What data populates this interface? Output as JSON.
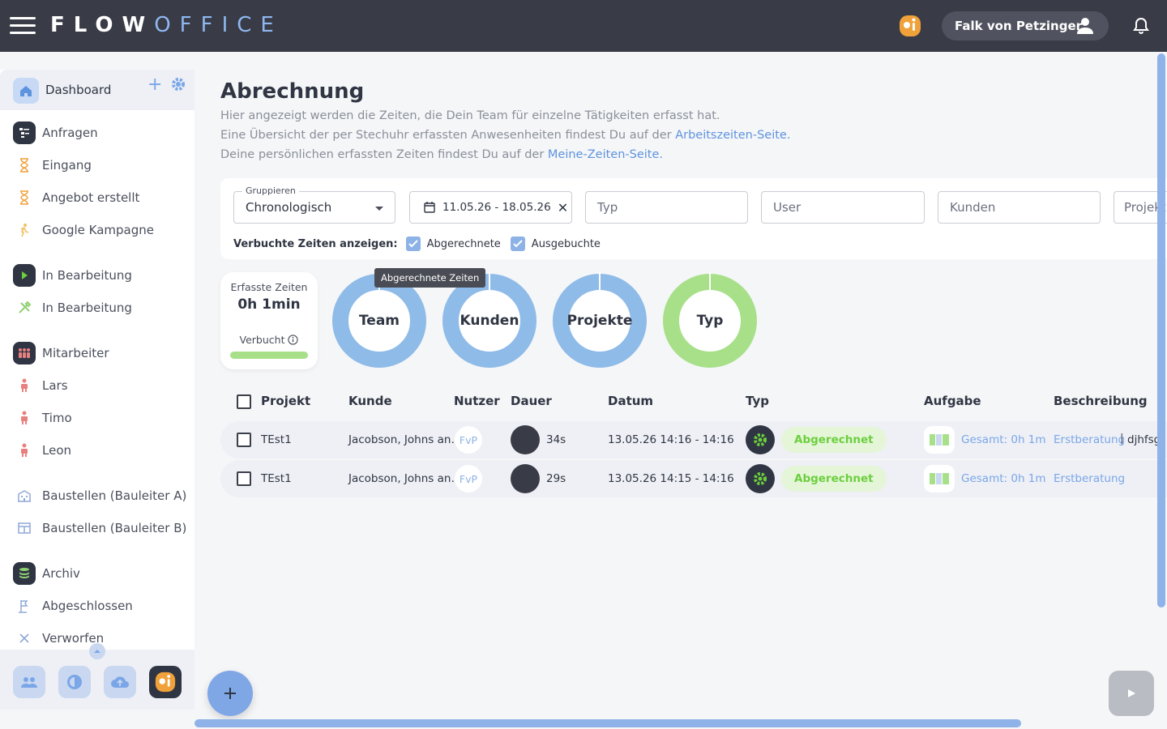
{
  "topbar": {
    "logo_bold": "FLOW",
    "logo_light": "OFFICE",
    "user_name": "Falk von Petzinger"
  },
  "sidebar": {
    "header_label": "Dashboard",
    "items": [
      {
        "label": "Anfragen",
        "icon": "inbox-list-icon"
      },
      {
        "label": "Eingang",
        "icon": "hourglass-icon"
      },
      {
        "label": "Angebot erstellt",
        "icon": "hourglass-icon"
      },
      {
        "label": "Google Kampagne",
        "icon": "walking-person-icon"
      },
      {
        "label": "In Bearbeitung",
        "icon": "play-icon"
      },
      {
        "label": "In Bearbeitung",
        "icon": "tools-icon"
      },
      {
        "label": "Mitarbeiter",
        "icon": "people-icon"
      },
      {
        "label": "Lars",
        "icon": "person-icon"
      },
      {
        "label": "Timo",
        "icon": "person-icon"
      },
      {
        "label": "Leon",
        "icon": "person-icon"
      },
      {
        "label": "Baustellen (Bauleiter A)",
        "icon": "building-icon"
      },
      {
        "label": "Baustellen (Bauleiter B)",
        "icon": "grid-icon"
      },
      {
        "label": "Archiv",
        "icon": "database-icon"
      },
      {
        "label": "Abgeschlossen",
        "icon": "flag-icon"
      },
      {
        "label": "Verworfen",
        "icon": "close-icon"
      }
    ]
  },
  "main": {
    "title": "Abrechnung",
    "desc1": "Hier angezeigt werden die Zeiten, die Dein Team für einzelne Tätigkeiten erfasst hat.",
    "desc2_prefix": "Eine Übersicht der per Stechuhr erfassten Anwesenheiten findest Du auf der ",
    "desc2_link": "Arbeitszeiten-Seite.",
    "desc3_prefix": "Deine persönlichen erfassten Zeiten findest Du auf der ",
    "desc3_link": "Meine-Zeiten-Seite."
  },
  "filters": {
    "group_label": "Gruppieren",
    "group_value": "Chronologisch",
    "date_range": "11.05.26 - 18.05.26",
    "typ_placeholder": "Typ",
    "user_placeholder": "User",
    "kunden_placeholder": "Kunden",
    "projekt_placeholder": "Projekt",
    "booked_label": "Verbuchte Zeiten anzeigen:",
    "opt_billed": "Abgerechnete",
    "opt_booked": "Ausgebuchte"
  },
  "stats": {
    "title": "Erfasste Zeiten",
    "total": "0h 1min",
    "status": "Verbucht",
    "tooltip": "Abgerechnete Zeiten",
    "donuts": [
      {
        "label": "Team",
        "color": "#8fbbe8"
      },
      {
        "label": "Kunden",
        "color": "#8fbbe8"
      },
      {
        "label": "Projekte",
        "color": "#8fbbe8"
      },
      {
        "label": "Typ",
        "color": "#a8e08a"
      }
    ]
  },
  "table": {
    "headers": {
      "projekt": "Projekt",
      "kunde": "Kunde",
      "nutzer": "Nutzer",
      "dauer": "Dauer",
      "datum": "Datum",
      "typ": "Typ",
      "aufgabe": "Aufgabe",
      "beschreibung": "Beschreibung"
    },
    "rows": [
      {
        "projekt": "TEst1",
        "kunde": "Jacobson, Johns an…",
        "nutzer": "FvP",
        "dauer": "34s",
        "datum": "13.05.26 14:16 - 14:16",
        "status": "Abgerechnet",
        "aufgabe": "Gesamt: 0h 1m",
        "beschreibung": "Erstberatung",
        "extra": "djhfsg"
      },
      {
        "projekt": "TEst1",
        "kunde": "Jacobson, Johns an…",
        "nutzer": "FvP",
        "dauer": "29s",
        "datum": "13.05.26 14:15 - 14:16",
        "status": "Abgerechnet",
        "aufgabe": "Gesamt: 0h 1m",
        "beschreibung": "Erstberatung",
        "extra": ""
      }
    ]
  },
  "colors": {
    "accent": "#7fa7e6",
    "topbar": "#393b46",
    "success": "#6ccf3e"
  }
}
